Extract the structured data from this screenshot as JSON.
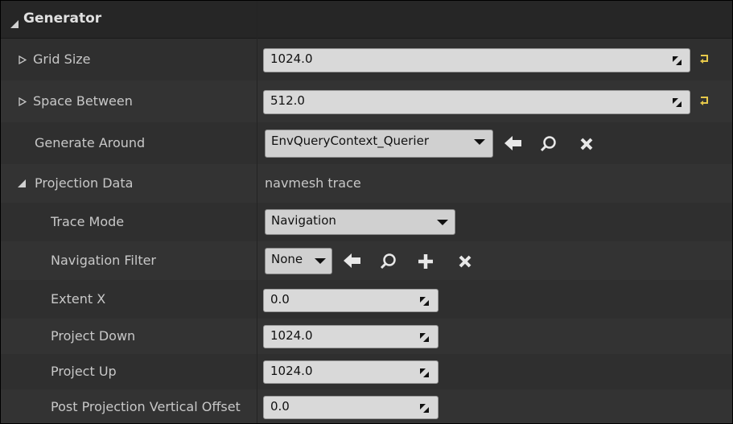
{
  "section": {
    "title": "Generator"
  },
  "rows": {
    "grid_size": {
      "label": "Grid Size",
      "value": "1024.0"
    },
    "space_between": {
      "label": "Space Between",
      "value": "512.0"
    },
    "generate_around": {
      "label": "Generate Around",
      "value": "EnvQueryContext_Querier"
    },
    "projection_data": {
      "label": "Projection Data",
      "value": "navmesh trace"
    },
    "trace_mode": {
      "label": "Trace Mode",
      "value": "Navigation"
    },
    "navigation_filter": {
      "label": "Navigation Filter",
      "value": "None"
    },
    "extent_x": {
      "label": "Extent X",
      "value": "0.0"
    },
    "project_down": {
      "label": "Project Down",
      "value": "1024.0"
    },
    "project_up": {
      "label": "Project Up",
      "value": "1024.0"
    },
    "post_projection": {
      "label": "Post Projection Vertical Offset",
      "value": "0.0"
    }
  },
  "colors": {
    "reset_arrow": "#e6c84a",
    "field_bg": "#d9d9d9",
    "panel_bg": "#2f2f2f"
  }
}
